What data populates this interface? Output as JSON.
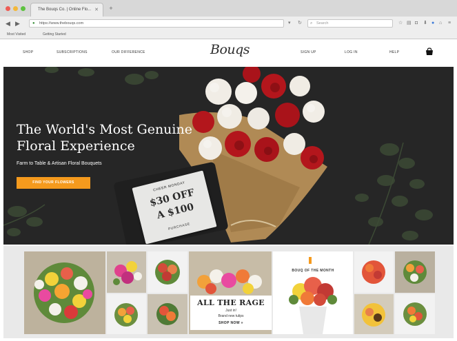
{
  "browser": {
    "tab_title": "The Bouqs Co. | Online Flo...",
    "url": "https://www.thebouqs.com",
    "search_placeholder": "Search",
    "bookmarks": [
      "Most Visited",
      "Getting Started"
    ]
  },
  "site": {
    "logo": "Bouqs",
    "nav_left": [
      "SHOP",
      "SUBSCRIPTIONS",
      "OUR DIFFERENCE"
    ],
    "nav_right": [
      "SIGN UP",
      "LOG IN",
      "HELP"
    ]
  },
  "hero": {
    "title_line1": "The World's Most Genuine",
    "title_line2": "Floral Experience",
    "subtitle": "Farm to Table & Artisan Floral Bouquets",
    "cta": "FIND YOUR FLOWERS",
    "promo": {
      "line1": "CHEER MONDAY",
      "line2": "$30 OFF",
      "line3": "A $100",
      "line4": "PURCHASE"
    }
  },
  "grid": {
    "rage_title": "ALL THE RAGE",
    "rage_sub1": "Just in!",
    "rage_sub2": "Brand new tulips",
    "rage_cta": "SHOP NOW »",
    "bouq_of_month": "BOUQ OF THE MONTH"
  },
  "colors": {
    "accent_orange": "#f59a1d",
    "hero_bg": "#262626",
    "grid_bg": "#e9e9e9"
  }
}
